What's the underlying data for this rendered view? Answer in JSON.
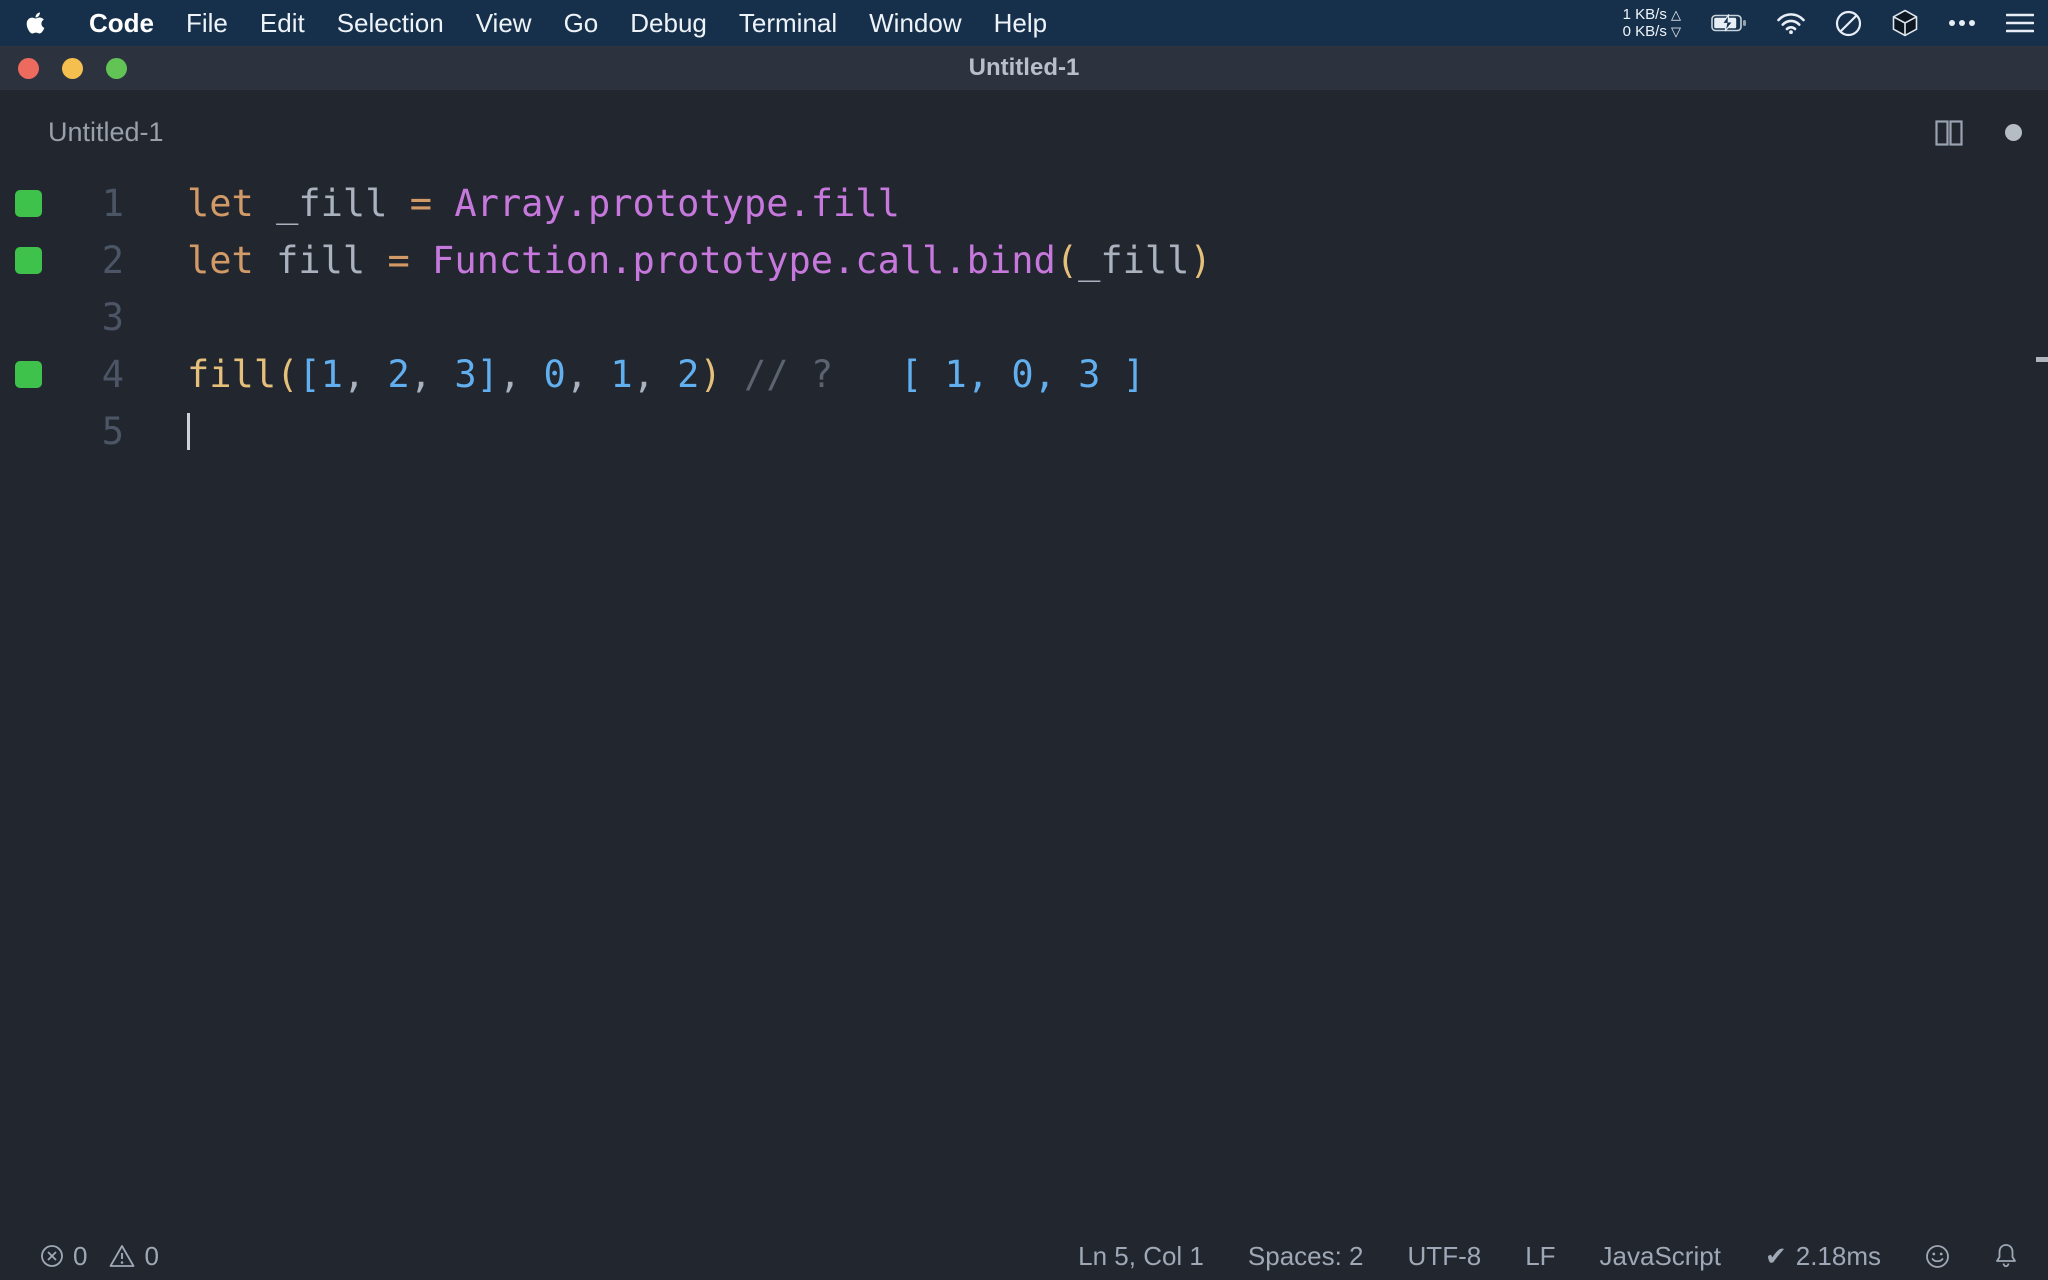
{
  "colors": {
    "keyword": "#d19a66",
    "operator": "#d19a66",
    "plain": "#abb2bf",
    "property": "#c678dd",
    "paren": "#e5c07b",
    "func": "#e5c07b",
    "number": "#61afef",
    "comment": "#5c6370",
    "result": "#61afef",
    "coverage": "#3fc24c",
    "close": "#ec6a5e",
    "min": "#f5bf4f",
    "zoom": "#61c455"
  },
  "menu_bar": {
    "app_name": "Code",
    "items": [
      "File",
      "Edit",
      "Selection",
      "View",
      "Go",
      "Debug",
      "Terminal",
      "Window",
      "Help"
    ],
    "net_up": "1 KB/s",
    "net_down": "0 KB/s",
    "net_up_arrow": "△",
    "net_down_arrow": "▽"
  },
  "window": {
    "title": "Untitled-1"
  },
  "tab": {
    "label": "Untitled-1"
  },
  "editor": {
    "lines": [
      {
        "number": "1",
        "covered": true,
        "tokens": [
          [
            "let",
            "keyword"
          ],
          [
            " _fill ",
            "plain"
          ],
          [
            "=",
            "operator"
          ],
          [
            " ",
            "plain"
          ],
          [
            "Array.prototype.fill",
            "property"
          ]
        ]
      },
      {
        "number": "2",
        "covered": true,
        "tokens": [
          [
            "let",
            "keyword"
          ],
          [
            " fill ",
            "plain"
          ],
          [
            "=",
            "operator"
          ],
          [
            " ",
            "plain"
          ],
          [
            "Function.prototype.call.bind",
            "property"
          ],
          [
            "(",
            "paren"
          ],
          [
            "_fill",
            "plain"
          ],
          [
            ")",
            "paren"
          ]
        ]
      },
      {
        "number": "3",
        "covered": false,
        "tokens": []
      },
      {
        "number": "4",
        "covered": true,
        "tokens": [
          [
            "fill",
            "func"
          ],
          [
            "(",
            "paren"
          ],
          [
            "[",
            "number"
          ],
          [
            "1",
            "number"
          ],
          [
            ", ",
            "plain"
          ],
          [
            "2",
            "number"
          ],
          [
            ", ",
            "plain"
          ],
          [
            "3",
            "number"
          ],
          [
            "]",
            "number"
          ],
          [
            ", ",
            "plain"
          ],
          [
            "0",
            "number"
          ],
          [
            ", ",
            "plain"
          ],
          [
            "1",
            "number"
          ],
          [
            ", ",
            "plain"
          ],
          [
            "2",
            "number"
          ],
          [
            ")",
            "paren"
          ],
          [
            " ",
            "plain"
          ],
          [
            "// ?",
            "comment"
          ],
          [
            "   ",
            "plain"
          ],
          [
            "[ 1, 0, 3 ]",
            "result"
          ]
        ]
      },
      {
        "number": "5",
        "covered": false,
        "tokens": [],
        "cursor": true
      }
    ]
  },
  "status_bar": {
    "errors": "0",
    "warnings": "0",
    "position": "Ln 5, Col 1",
    "indent": "Spaces: 2",
    "encoding": "UTF-8",
    "eol": "LF",
    "language": "JavaScript",
    "perf_check": "✔",
    "perf": "2.18ms"
  }
}
